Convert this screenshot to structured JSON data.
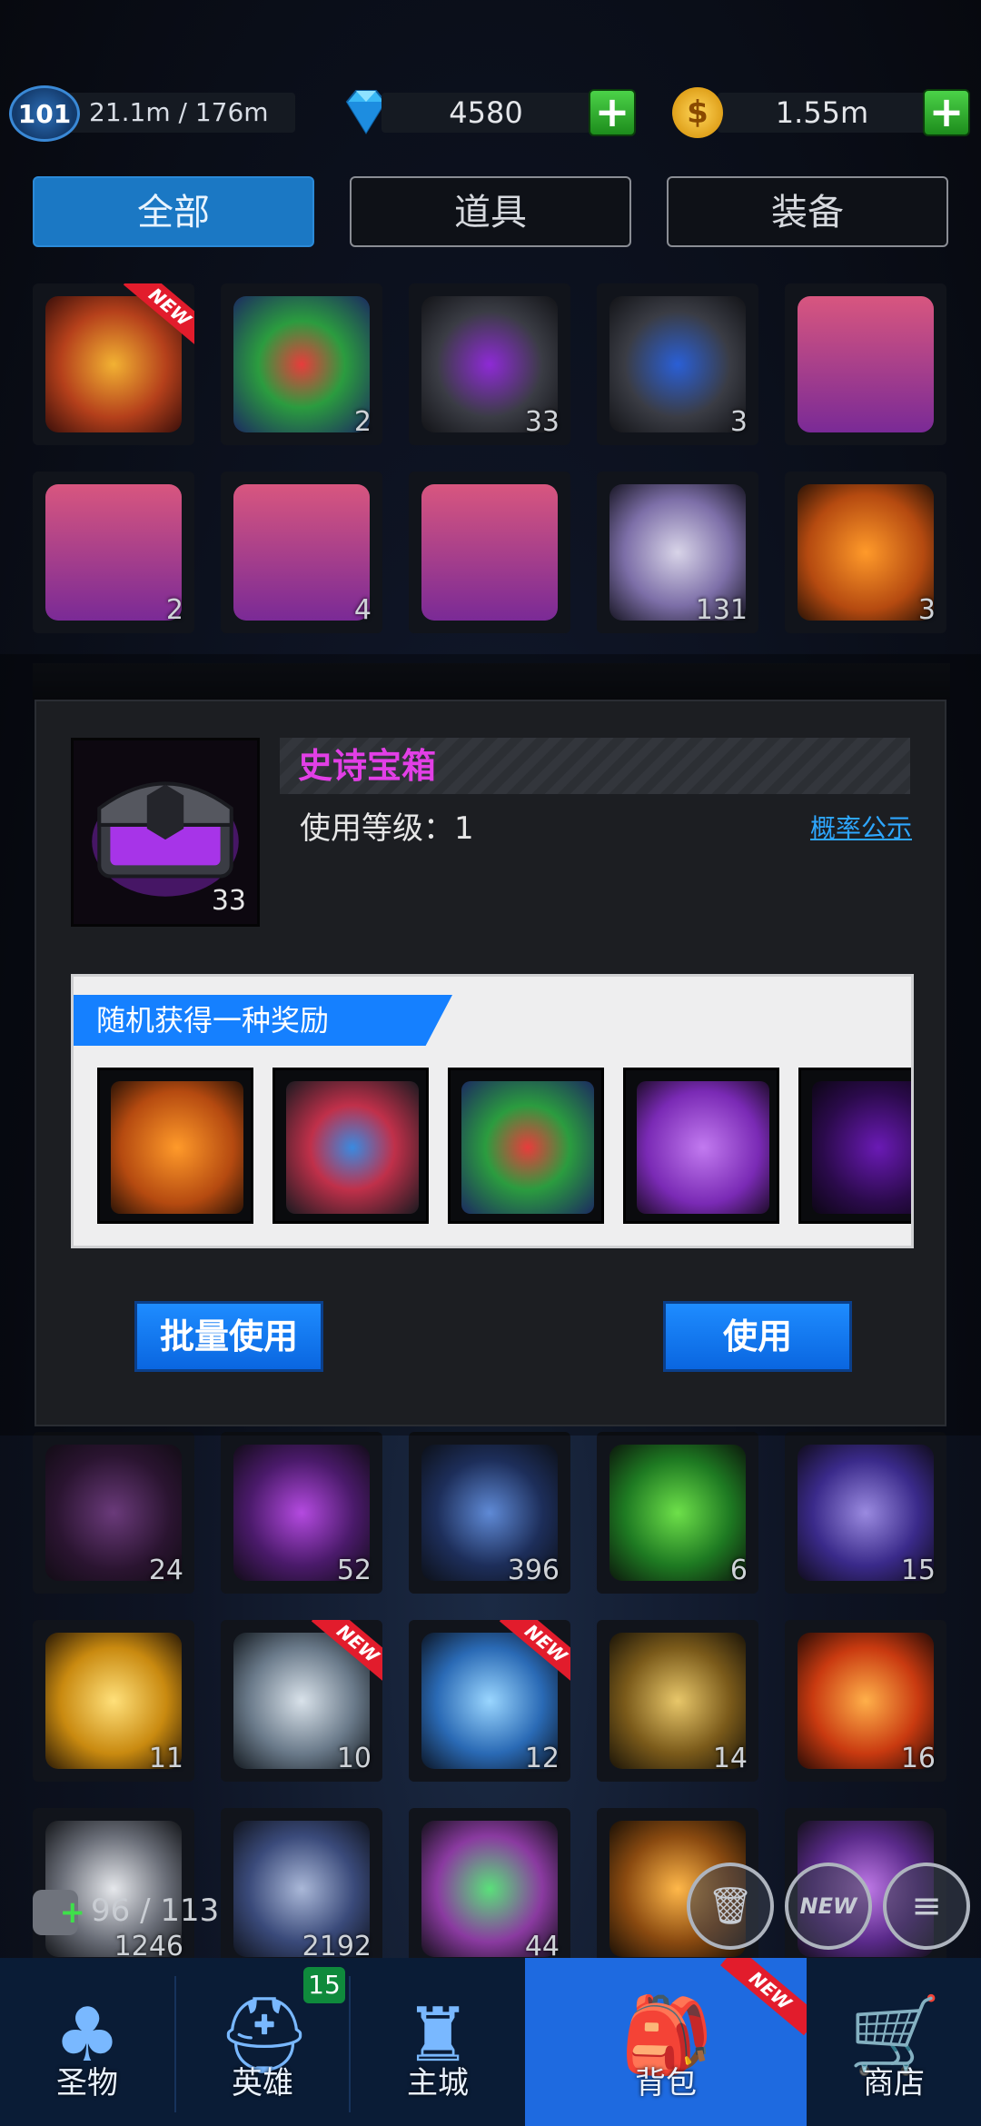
{
  "header": {
    "level": "101",
    "exp": "21.1m / 176m",
    "gems": "4580",
    "gold": "1.55m",
    "coin_symbol": "$",
    "plus_symbol": "+"
  },
  "tabs": [
    {
      "label": "全部",
      "active": true
    },
    {
      "label": "道具",
      "active": false
    },
    {
      "label": "装备",
      "active": false
    }
  ],
  "grid_top_rows": [
    [
      {
        "icon": "golden-chest-icon",
        "count": "",
        "new": true
      },
      {
        "icon": "mystery-gem-icon",
        "count": "2",
        "new": false
      },
      {
        "icon": "purple-chest-icon",
        "count": "33",
        "new": false
      },
      {
        "icon": "blue-chest-icon",
        "count": "3",
        "new": false
      },
      {
        "icon": "card-pack-icon",
        "count": "",
        "new": false
      }
    ],
    [
      {
        "icon": "card-pack-icon",
        "count": "2",
        "new": false
      },
      {
        "icon": "card-pack-icon",
        "count": "4",
        "new": false
      },
      {
        "icon": "card-pack-icon",
        "count": "",
        "new": false
      },
      {
        "icon": "crystal-icon",
        "count": "131",
        "new": false
      },
      {
        "icon": "paw-ticket-icon",
        "count": "3",
        "new": false
      }
    ]
  ],
  "grid_bottom_rows": [
    [
      {
        "icon": "scroll-icon",
        "count": "24",
        "new": false
      },
      {
        "icon": "purple-swirl-icon",
        "count": "52",
        "new": false
      },
      {
        "icon": "blue-swirl-icon",
        "count": "396",
        "new": false
      },
      {
        "icon": "green-emblem-icon",
        "count": "6",
        "new": false
      },
      {
        "icon": "moon-star-icon",
        "count": "15",
        "new": false
      }
    ],
    [
      {
        "icon": "gold-star-icon",
        "count": "11",
        "new": false
      },
      {
        "icon": "silver-star-icon",
        "count": "10",
        "new": true
      },
      {
        "icon": "water-star-icon",
        "count": "12",
        "new": true
      },
      {
        "icon": "leaf-star-icon",
        "count": "14",
        "new": false
      },
      {
        "icon": "fire-star-icon",
        "count": "16",
        "new": false
      }
    ],
    [
      {
        "icon": "feather-icon",
        "count": "1246",
        "new": false
      },
      {
        "icon": "diamond-icon",
        "count": "2192",
        "new": false
      },
      {
        "icon": "clover-green-icon",
        "count": "44",
        "new": false
      },
      {
        "icon": "clover-orange-icon",
        "count": "",
        "new": false
      },
      {
        "icon": "clover-purple-icon",
        "count": "",
        "new": false
      }
    ]
  ],
  "new_badge": "NEW",
  "modal": {
    "title": "史诗宝箱",
    "count": "33",
    "level": "使用等级：1",
    "probability_link": "概率公示",
    "reward_header": "随机获得一种奖励",
    "rewards": [
      {
        "icon": "orange-paw-ticket-icon"
      },
      {
        "icon": "gem-cluster-icon"
      },
      {
        "icon": "mystery-gem-icon"
      },
      {
        "icon": "purple-paw-ticket-icon"
      },
      {
        "icon": "question-mark-icon"
      }
    ],
    "batch_use": "批量使用",
    "use": "使用"
  },
  "capacity": "96 / 113",
  "nav": [
    {
      "label": "圣物",
      "icon": "clover-icon",
      "active": false
    },
    {
      "label": "英雄",
      "icon": "helmet-icon",
      "badge": "15",
      "active": false
    },
    {
      "label": "主城",
      "icon": "castle-icon",
      "active": false
    },
    {
      "label": "背包",
      "icon": "backpack-icon",
      "active": true,
      "new": true
    },
    {
      "label": "商店",
      "icon": "cart-icon",
      "active": false
    }
  ],
  "colors": {
    "accent_blue": "#1e8cff",
    "title_magenta": "#e23fe6",
    "link_blue": "#2ea7ff",
    "new_red": "#e21c2c"
  }
}
